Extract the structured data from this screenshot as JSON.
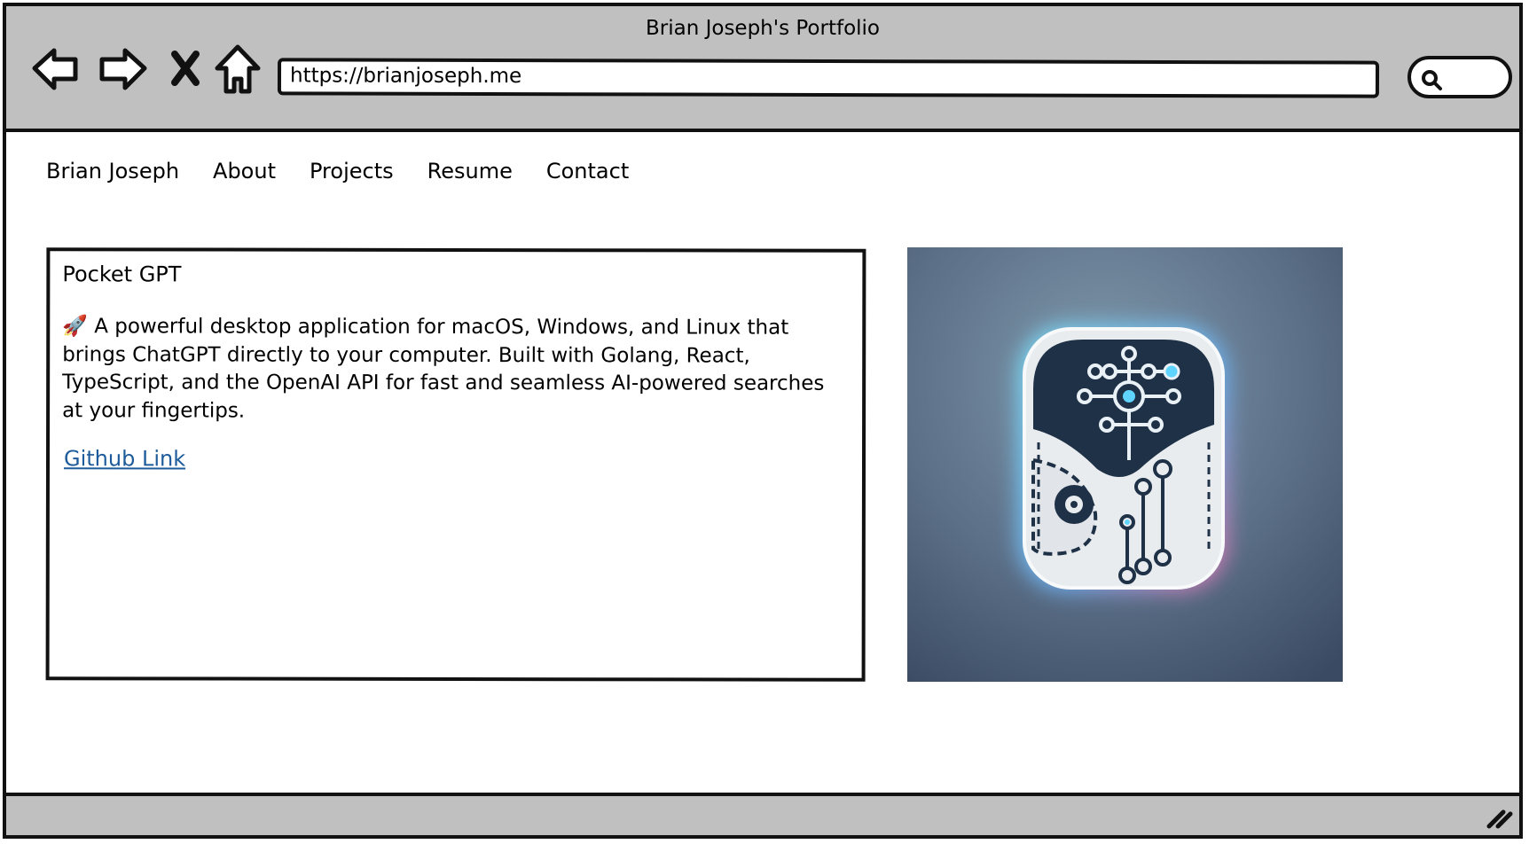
{
  "window": {
    "title": "Brian Joseph's Portfolio"
  },
  "toolbar": {
    "back_icon": "back-arrow-icon",
    "forward_icon": "forward-arrow-icon",
    "stop_icon": "close-icon",
    "home_icon": "home-icon",
    "url": "https://brianjoseph.me",
    "search_icon": "search-icon"
  },
  "nav": {
    "items": [
      {
        "label": "Brian Joseph"
      },
      {
        "label": "About"
      },
      {
        "label": "Projects"
      },
      {
        "label": "Resume"
      },
      {
        "label": "Contact"
      }
    ]
  },
  "project": {
    "title": "Pocket GPT",
    "emoji": "🚀",
    "description": "A powerful desktop application for macOS, Windows, and Linux that brings ChatGPT directly to your computer. Built with Golang, React, TypeScript, and the OpenAI API for fast and seamless AI-powered searches at your fingertips.",
    "link_label": "Github Link",
    "image_icon": "circuit-pocket-icon"
  },
  "colors": {
    "chrome": "#c0c0c0",
    "link": "#1e5b9a",
    "image_bg_top": "#7892a6",
    "image_bg_bottom": "#3a4a62"
  }
}
